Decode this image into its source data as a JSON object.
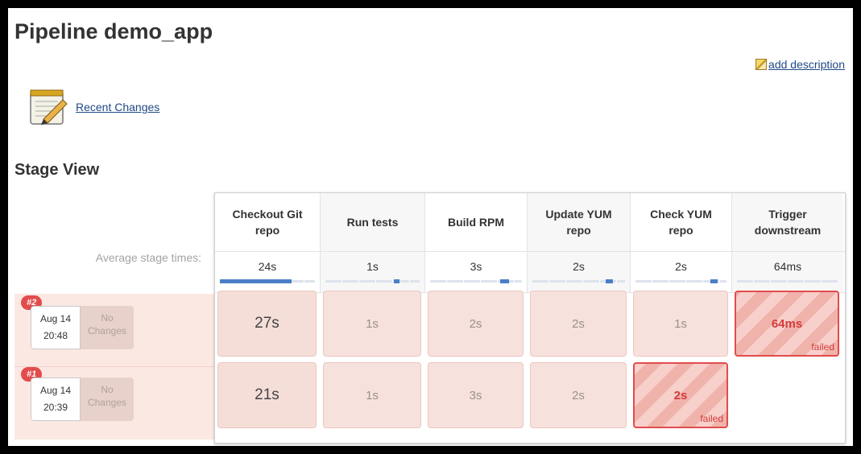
{
  "page": {
    "title": "Pipeline demo_app",
    "add_description": "add description",
    "recent_changes": "Recent Changes",
    "stage_view_title": "Stage View"
  },
  "stages": [
    {
      "name": "Checkout Git repo",
      "avg": "24s",
      "avg_fraction": 0.75
    },
    {
      "name": "Run tests",
      "avg": "1s",
      "avg_fraction": 0.05
    },
    {
      "name": "Build RPM",
      "avg": "3s",
      "avg_fraction": 0.1
    },
    {
      "name": "Update YUM repo",
      "avg": "2s",
      "avg_fraction": 0.08
    },
    {
      "name": "Check YUM repo",
      "avg": "2s",
      "avg_fraction": 0.08
    },
    {
      "name": "Trigger downstream",
      "avg": "64ms",
      "avg_fraction": 0.0
    }
  ],
  "avg_label": "Average stage times:",
  "builds": [
    {
      "number": "#2",
      "date": "Aug 14",
      "time": "20:48",
      "changes": "No Changes",
      "cells": [
        {
          "text": "27s",
          "status": "success"
        },
        {
          "text": "1s",
          "status": "success"
        },
        {
          "text": "2s",
          "status": "success"
        },
        {
          "text": "2s",
          "status": "success"
        },
        {
          "text": "1s",
          "status": "success"
        },
        {
          "text": "64ms",
          "status": "failed",
          "tag": "failed"
        }
      ]
    },
    {
      "number": "#1",
      "date": "Aug 14",
      "time": "20:39",
      "changes": "No Changes",
      "cells": [
        {
          "text": "21s",
          "status": "success"
        },
        {
          "text": "1s",
          "status": "success"
        },
        {
          "text": "3s",
          "status": "success"
        },
        {
          "text": "2s",
          "status": "success"
        },
        {
          "text": "2s",
          "status": "failed",
          "tag": "failed"
        },
        null
      ]
    }
  ],
  "colors": {
    "failed": "#e24c4c",
    "progress": "#4a7fc8",
    "row_bg": "#fbe8e3"
  }
}
